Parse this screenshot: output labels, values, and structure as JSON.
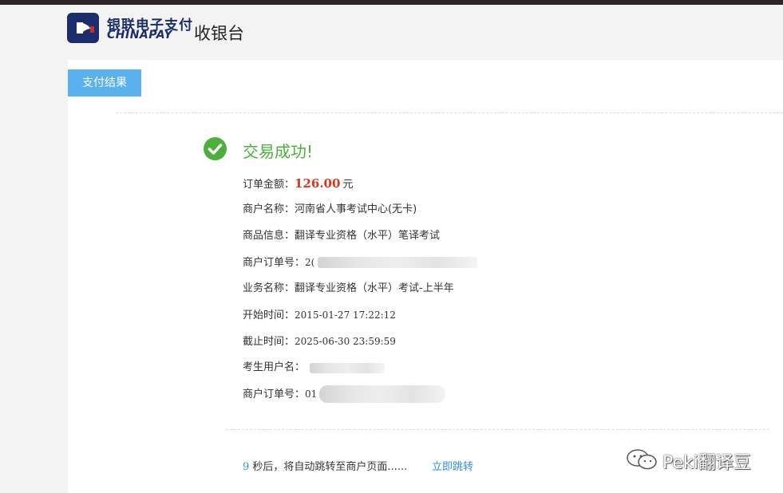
{
  "header": {
    "brand_cn": "银联电子支付",
    "brand_en": "CHINAPAY",
    "cashier": "收银台"
  },
  "tabs": {
    "result": "支付结果"
  },
  "result": {
    "title": "交易成功!",
    "rows": [
      {
        "label": "订单金额：",
        "value": "126.00",
        "unit": "元"
      },
      {
        "label": "商户名称：",
        "value": "河南省人事考试中心(无卡)"
      },
      {
        "label": "商品信息：",
        "value": "翻译专业资格（水平）笔译考试"
      },
      {
        "label": "商户订单号：",
        "value": "2("
      },
      {
        "label": "业务名称：",
        "value": "翻译专业资格（水平）考试-上半年"
      },
      {
        "label": "开始时间：",
        "value": "2015-01-27 17:22:12"
      },
      {
        "label": "截止时间：",
        "value": "2025-06-30 23:59:59"
      },
      {
        "label": "考生用户名：",
        "value": ""
      },
      {
        "label": "商户订单号：",
        "value": "01"
      }
    ]
  },
  "redirect": {
    "seconds": "9",
    "text": "秒后，将自动跳转至商户页面......",
    "link": "立即跳转"
  },
  "watermark": {
    "text": "Peki翻译豆"
  },
  "colors": {
    "success": "#4caf3b",
    "amount": "#d9361a",
    "link": "#2f8fdb",
    "tab": "#5ab1ef",
    "brand": "#1c2d6b"
  }
}
